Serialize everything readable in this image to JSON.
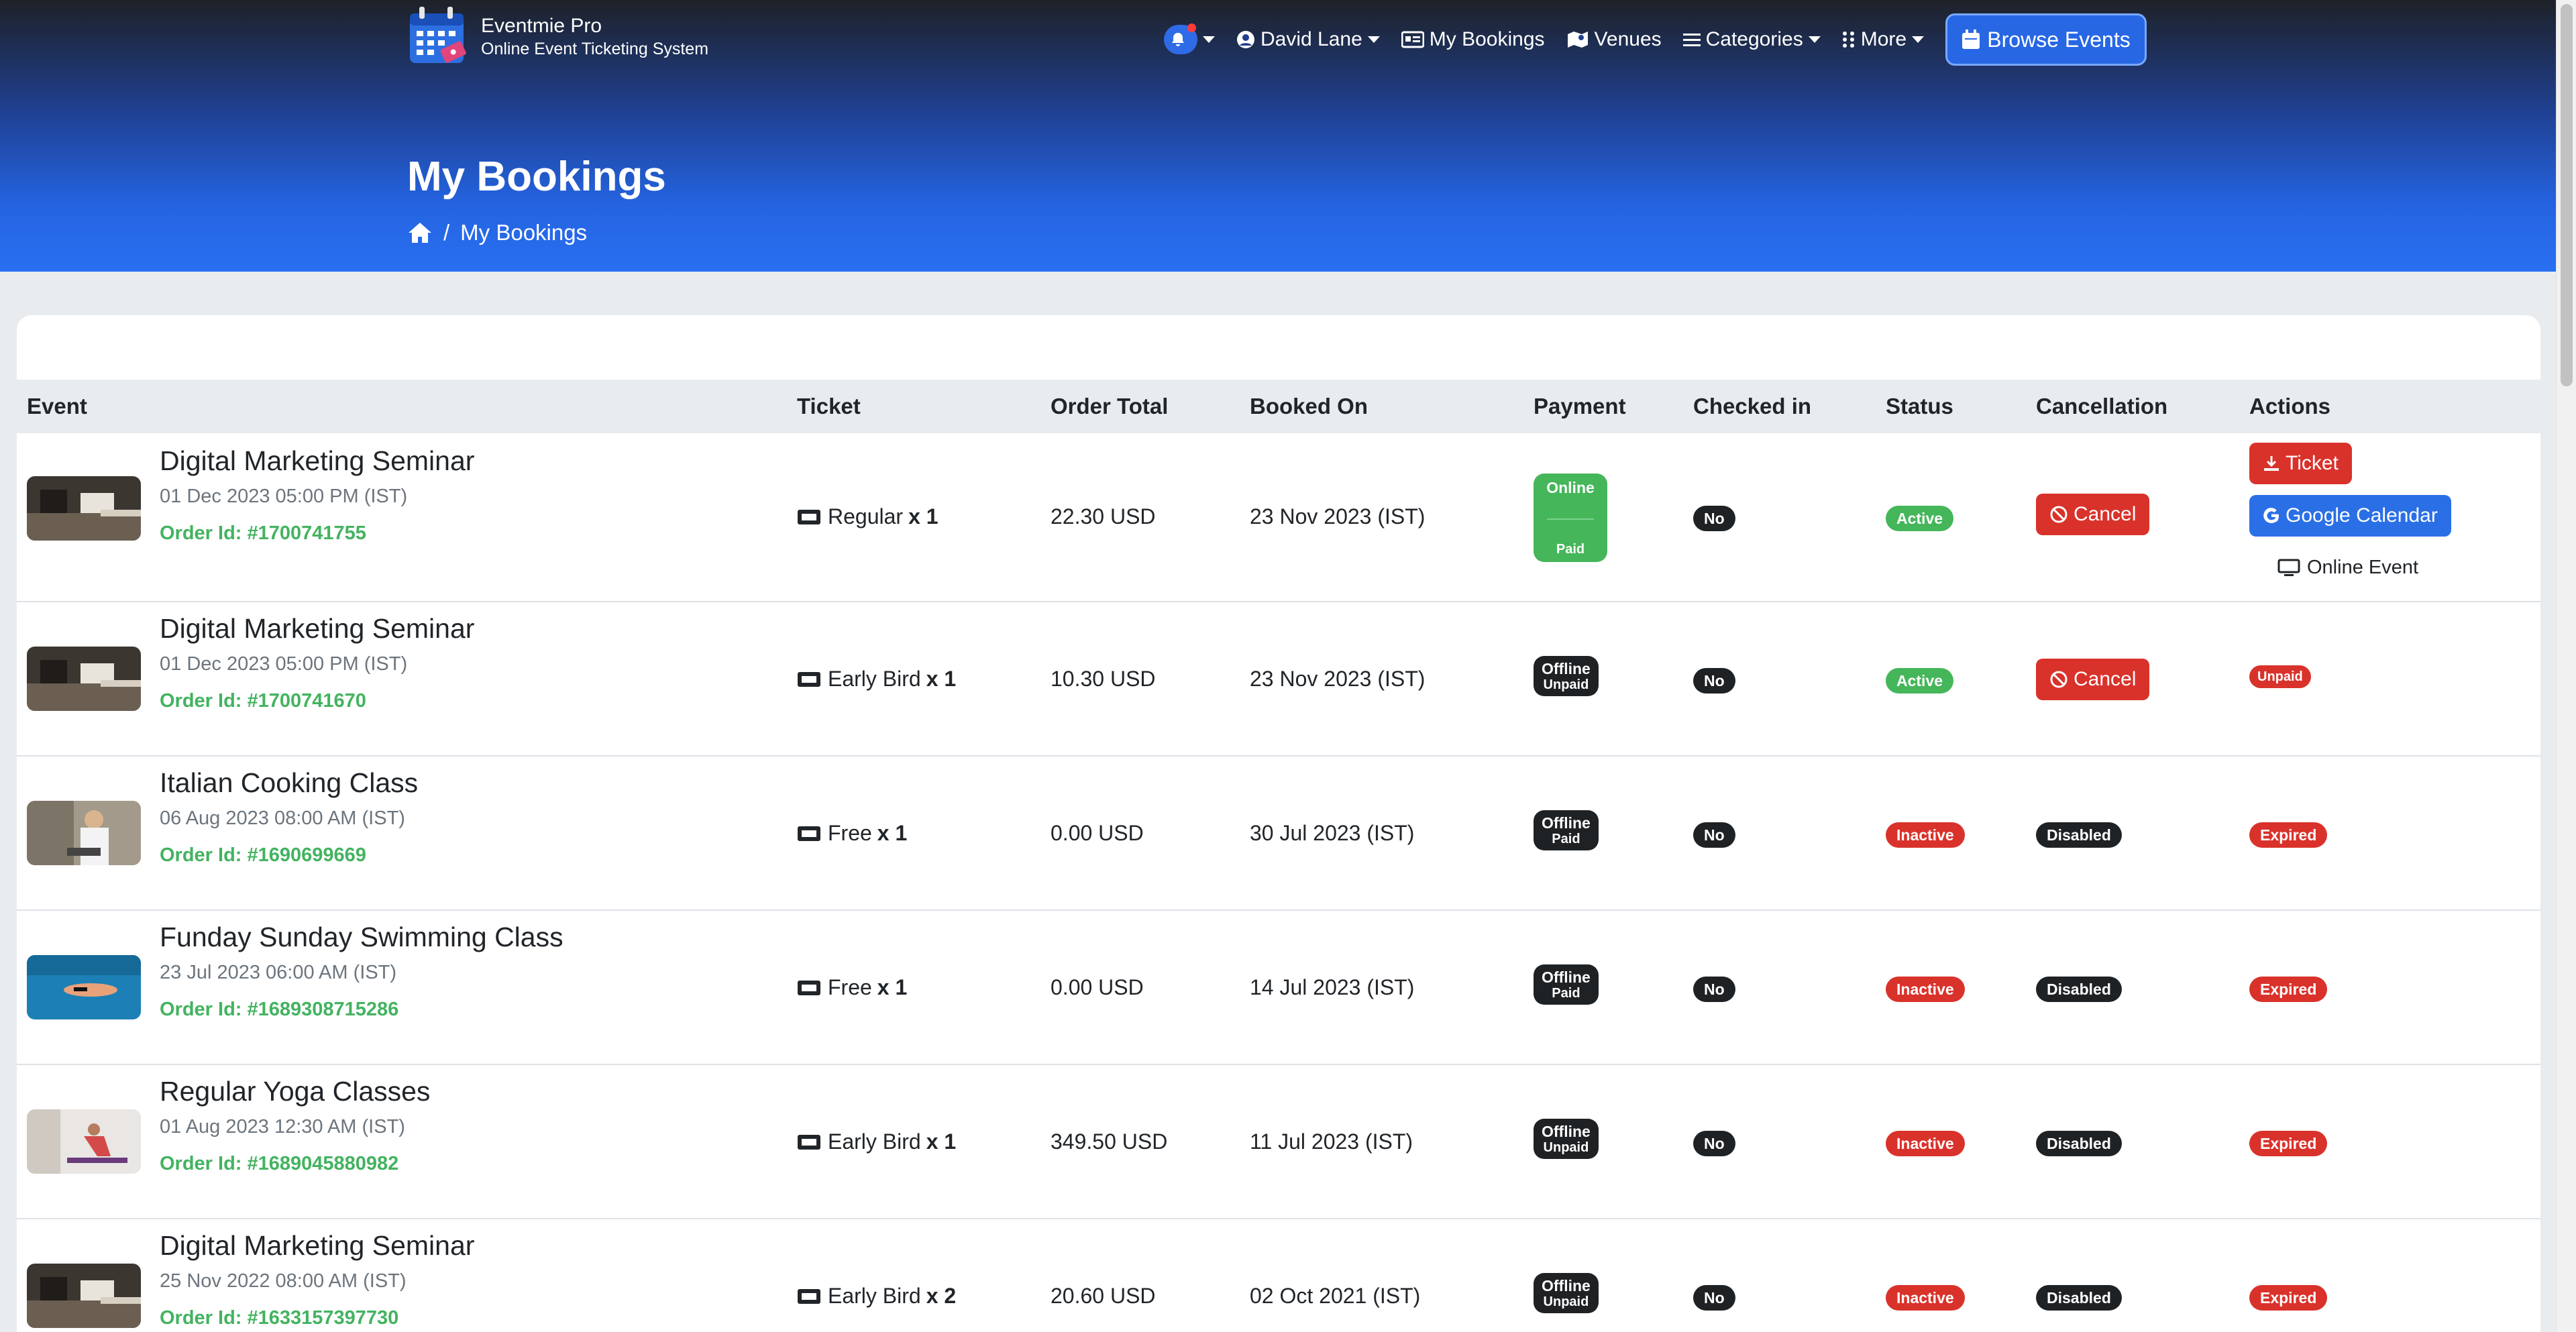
{
  "brand": {
    "name": "Eventmie Pro",
    "tagline": "Online Event Ticketing System"
  },
  "nav": {
    "user": "David Lane",
    "my_bookings": "My Bookings",
    "venues": "Venues",
    "categories": "Categories",
    "more": "More",
    "browse": "Browse Events"
  },
  "page": {
    "title": "My Bookings",
    "breadcrumb_current": "My Bookings",
    "breadcrumb_sep": "/"
  },
  "table": {
    "headers": {
      "event": "Event",
      "ticket": "Ticket",
      "total": "Order Total",
      "booked": "Booked On",
      "payment": "Payment",
      "checked": "Checked in",
      "status": "Status",
      "cancellation": "Cancellation",
      "actions": "Actions"
    },
    "rows": [
      {
        "title": "Digital Marketing Seminar",
        "date": "01 Dec 2023 05:00 PM (IST)",
        "order": "Order Id: #1700741755",
        "ticket": "Regular",
        "qty": "x 1",
        "total": "22.30 USD",
        "booked": "23 Nov 2023 (IST)",
        "pay1": "Online",
        "pay2": "Paid",
        "checked": "No",
        "status": "Active",
        "cancel": "Cancel",
        "action_ticket": "Ticket",
        "action_gcal": "Google Calendar",
        "action_online": "Online Event"
      },
      {
        "title": "Digital Marketing Seminar",
        "date": "01 Dec 2023 05:00 PM (IST)",
        "order": "Order Id: #1700741670",
        "ticket": "Early Bird",
        "qty": "x 1",
        "total": "10.30 USD",
        "booked": "23 Nov 2023 (IST)",
        "pay1": "Offline",
        "pay2": "Unpaid",
        "checked": "No",
        "status": "Active",
        "cancel": "Cancel",
        "action": "Unpaid"
      },
      {
        "title": "Italian Cooking Class",
        "date": "06 Aug 2023 08:00 AM (IST)",
        "order": "Order Id: #1690699669",
        "ticket": "Free",
        "qty": "x 1",
        "total": "0.00 USD",
        "booked": "30 Jul 2023 (IST)",
        "pay1": "Offline",
        "pay2": "Paid",
        "checked": "No",
        "status": "Inactive",
        "cancel": "Disabled",
        "action": "Expired"
      },
      {
        "title": "Funday Sunday Swimming Class",
        "date": "23 Jul 2023 06:00 AM (IST)",
        "order": "Order Id: #1689308715286",
        "ticket": "Free",
        "qty": "x 1",
        "total": "0.00 USD",
        "booked": "14 Jul 2023 (IST)",
        "pay1": "Offline",
        "pay2": "Paid",
        "checked": "No",
        "status": "Inactive",
        "cancel": "Disabled",
        "action": "Expired"
      },
      {
        "title": "Regular Yoga Classes",
        "date": "01 Aug 2023 12:30 AM (IST)",
        "order": "Order Id: #1689045880982",
        "ticket": "Early Bird",
        "qty": "x 1",
        "total": "349.50 USD",
        "booked": "11 Jul 2023 (IST)",
        "pay1": "Offline",
        "pay2": "Unpaid",
        "checked": "No",
        "status": "Inactive",
        "cancel": "Disabled",
        "action": "Expired"
      },
      {
        "title": "Digital Marketing Seminar",
        "date": "25 Nov 2022 08:00 AM (IST)",
        "order": "Order Id: #1633157397730",
        "ticket": "Early Bird",
        "qty": "x 2",
        "total": "20.60 USD",
        "booked": "02 Oct 2021 (IST)",
        "pay1": "Offline",
        "pay2": "Unpaid",
        "checked": "No",
        "status": "Inactive",
        "cancel": "Disabled",
        "action": "Expired"
      }
    ]
  },
  "colors": {
    "accent": "#2970f2",
    "success": "#45b65a",
    "danger": "#d9322b",
    "dark": "#1f2225"
  }
}
